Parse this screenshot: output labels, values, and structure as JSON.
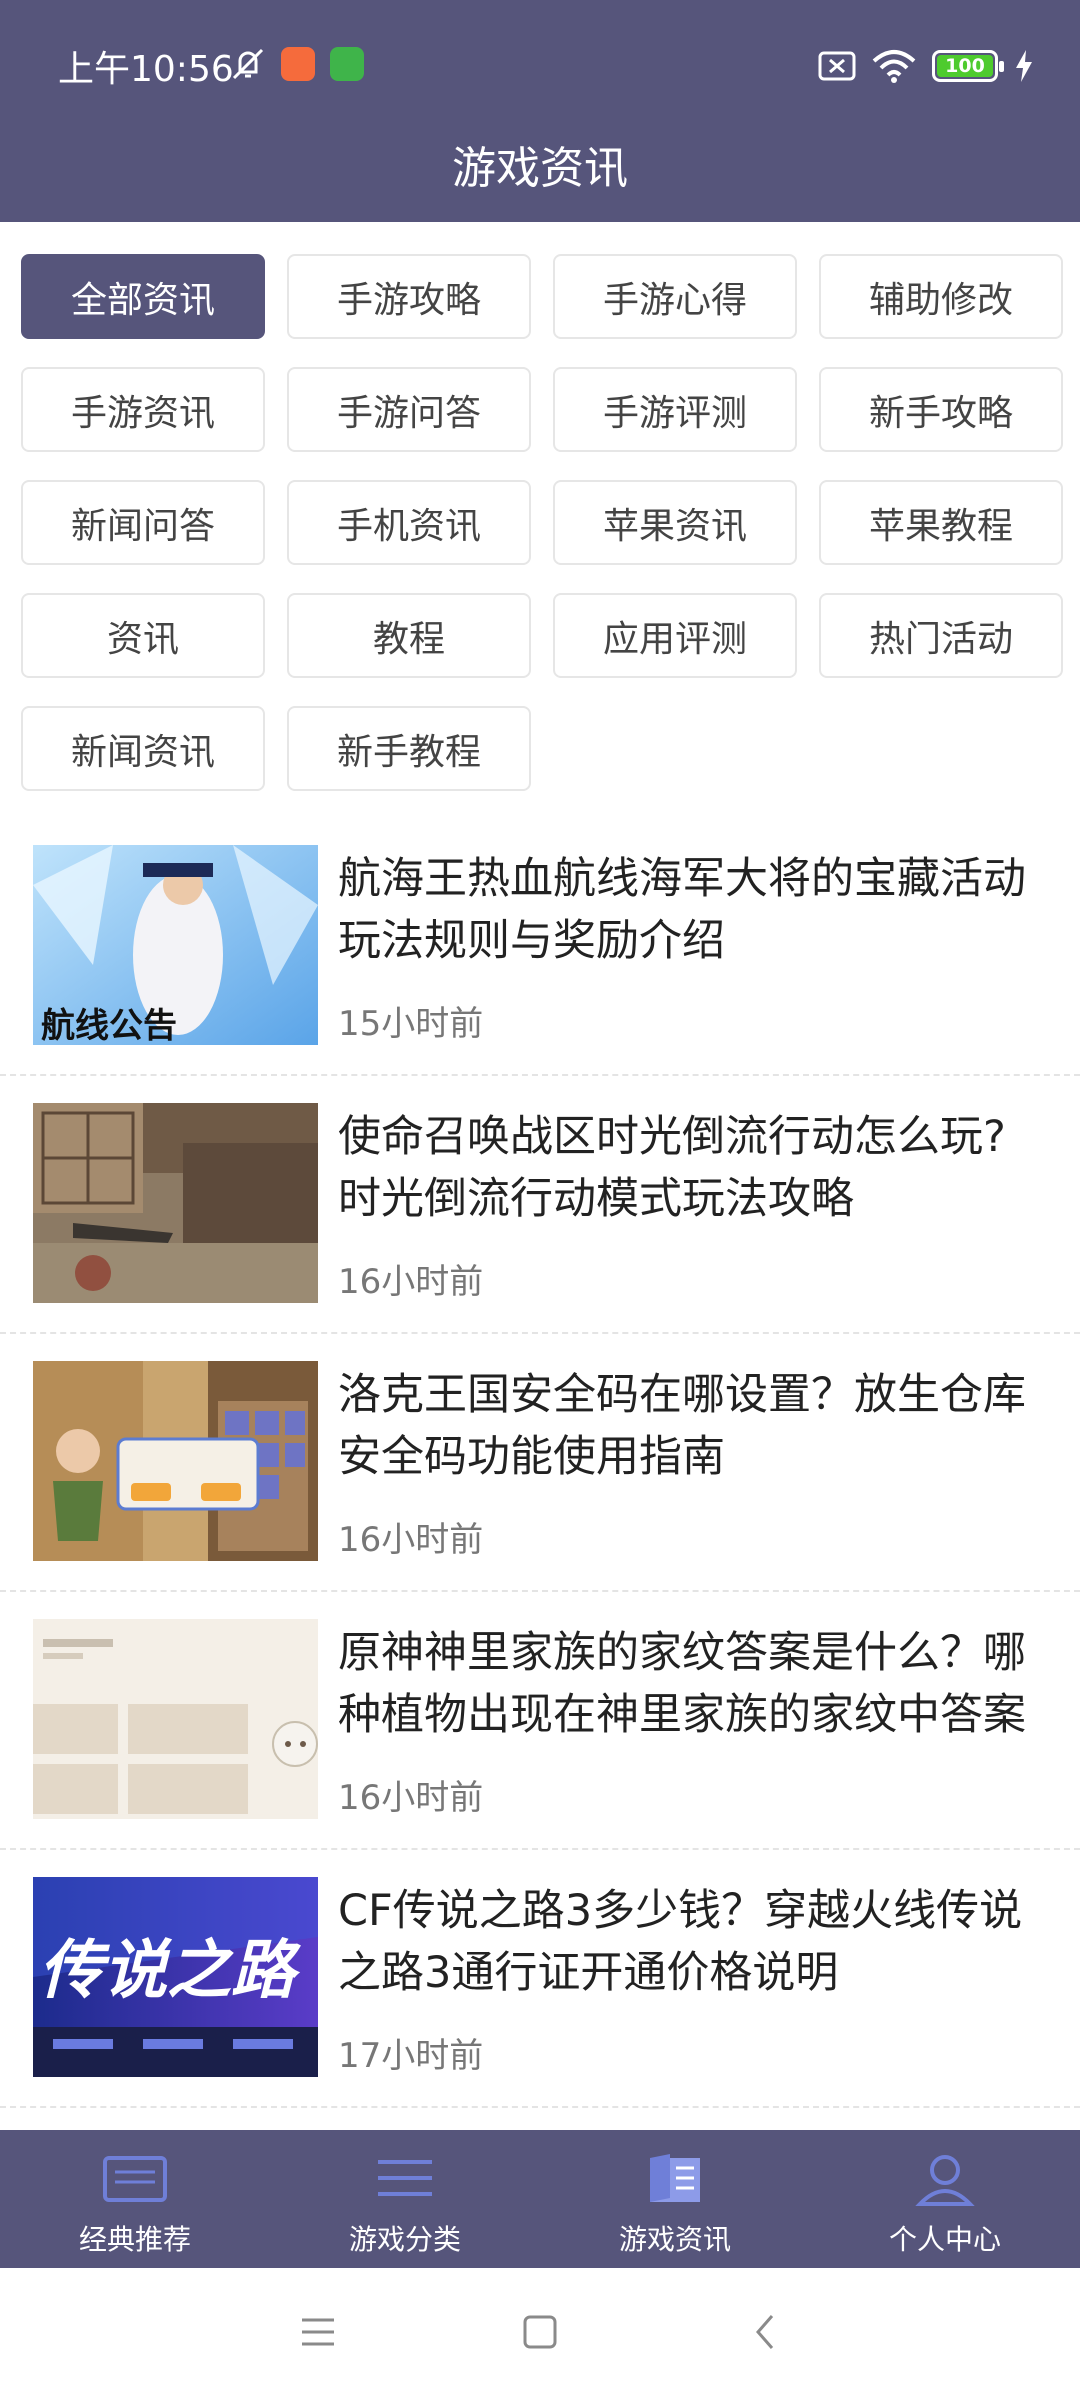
{
  "status_bar": {
    "time": "上午10:56",
    "battery": "100",
    "icons": [
      "mute-icon",
      "app-notification-icon",
      "android-icon",
      "sim-off-icon",
      "wifi-icon",
      "battery-icon",
      "charging-icon"
    ]
  },
  "header": {
    "title": "游戏资讯"
  },
  "categories": [
    {
      "label": "全部资讯",
      "active": true
    },
    {
      "label": "手游攻略",
      "active": false
    },
    {
      "label": "手游心得",
      "active": false
    },
    {
      "label": "辅助修改",
      "active": false
    },
    {
      "label": "手游资讯",
      "active": false
    },
    {
      "label": "手游问答",
      "active": false
    },
    {
      "label": "手游评测",
      "active": false
    },
    {
      "label": "新手攻略",
      "active": false
    },
    {
      "label": "新闻问答",
      "active": false
    },
    {
      "label": "手机资讯",
      "active": false
    },
    {
      "label": "苹果资讯",
      "active": false
    },
    {
      "label": "苹果教程",
      "active": false
    },
    {
      "label": "资讯",
      "active": false
    },
    {
      "label": "教程",
      "active": false
    },
    {
      "label": "应用评测",
      "active": false
    },
    {
      "label": "热门活动",
      "active": false
    },
    {
      "label": "新闻资讯",
      "active": false
    },
    {
      "label": "新手教程",
      "active": false
    }
  ],
  "news": [
    {
      "title": "航海王热血航线海军大将的宝藏活动玩法规则与奖励介绍",
      "time": "15小时前"
    },
    {
      "title": "使命召唤战区时光倒流行动怎么玩?时光倒流行动模式玩法攻略",
      "time": "16小时前"
    },
    {
      "title": "洛克王国安全码在哪设置？放生仓库安全码功能使用指南",
      "time": "16小时前"
    },
    {
      "title": "原神神里家族的家纹答案是什么？哪种植物出现在神里家族的家纹中答案",
      "time": "16小时前"
    },
    {
      "title": "CF传说之路3多少钱？穿越火线传说之路3通行证开通价格说明",
      "time": "17小时前"
    }
  ],
  "thumbnail_text": [
    "航线公告",
    "传说之路"
  ],
  "tabbar": [
    {
      "label": "经典推荐",
      "icon": "monitor-icon"
    },
    {
      "label": "游戏分类",
      "icon": "list-icon"
    },
    {
      "label": "游戏资讯",
      "icon": "book-icon",
      "active": true
    },
    {
      "label": "个人中心",
      "icon": "person-icon"
    }
  ],
  "colors": {
    "primary": "#56557b",
    "tab_icon": "#6f7fd8",
    "tab_icon_active": "#8d9be8"
  }
}
